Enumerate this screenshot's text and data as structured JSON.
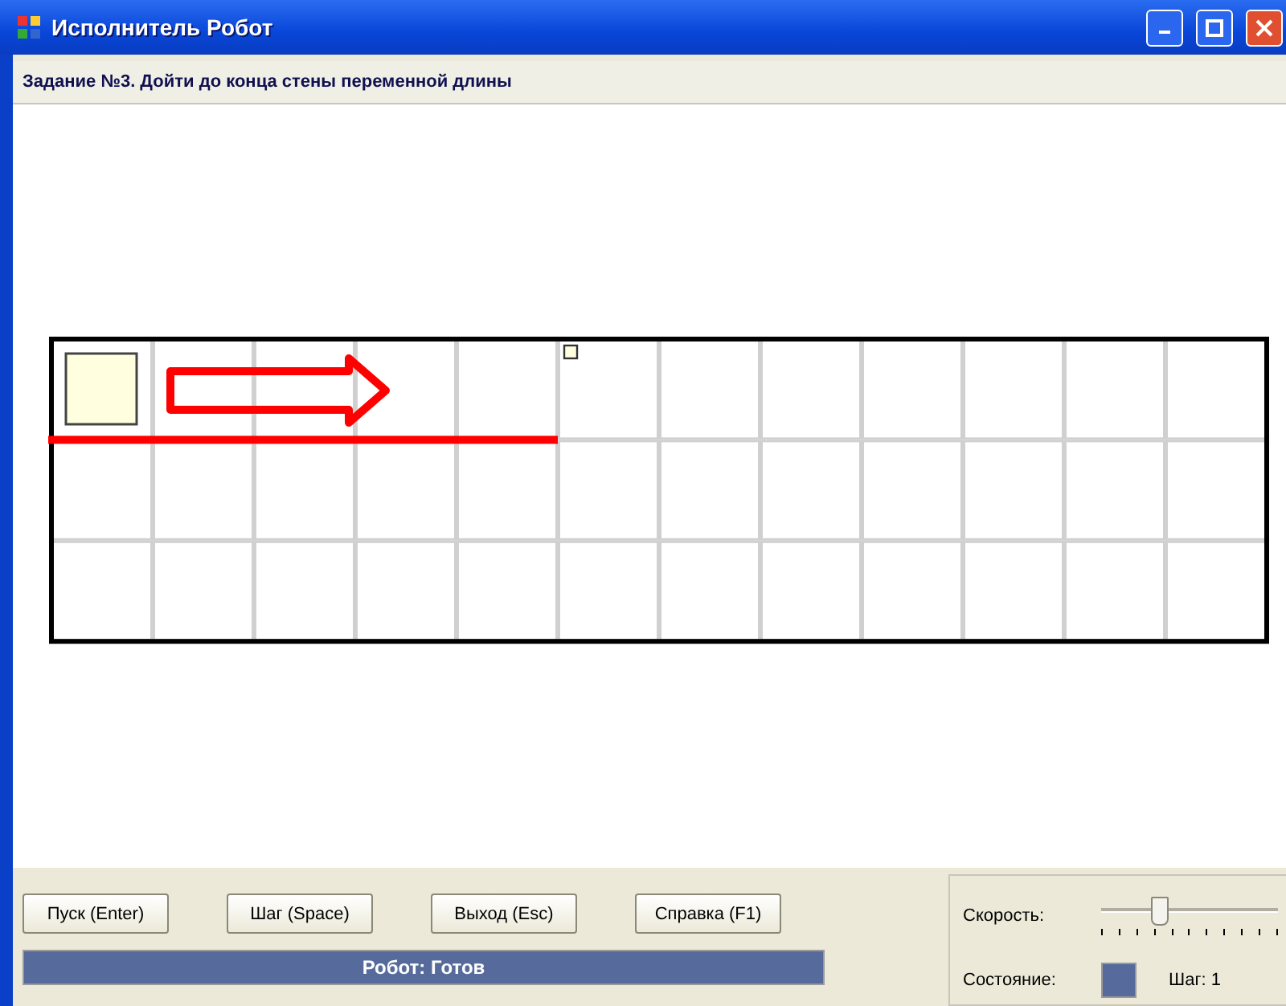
{
  "window": {
    "title": "Исполнитель Робот"
  },
  "task": "Задание №3. Дойти до конца стены переменной длины",
  "board": {
    "rows": [
      {
        "cells": [
          {
            "robot": true,
            "marker": false,
            "wall_below": true
          },
          {
            "robot": false,
            "marker": false,
            "wall_below": true
          },
          {
            "robot": false,
            "marker": false,
            "wall_below": true
          },
          {
            "robot": false,
            "marker": false,
            "wall_below": true
          },
          {
            "robot": false,
            "marker": false,
            "wall_below": true
          },
          {
            "robot": false,
            "marker": true,
            "wall_below": false
          },
          {
            "robot": false,
            "marker": false,
            "wall_below": false
          },
          {
            "robot": false,
            "marker": false,
            "wall_below": false
          },
          {
            "robot": false,
            "marker": false,
            "wall_below": false
          },
          {
            "robot": false,
            "marker": false,
            "wall_below": false
          },
          {
            "robot": false,
            "marker": false,
            "wall_below": false
          },
          {
            "robot": false,
            "marker": false,
            "wall_below": false
          }
        ]
      },
      {
        "cells": [
          {
            "robot": false,
            "marker": false,
            "wall_below": false
          },
          {
            "robot": false,
            "marker": false,
            "wall_below": false
          },
          {
            "robot": false,
            "marker": false,
            "wall_below": false
          },
          {
            "robot": false,
            "marker": false,
            "wall_below": false
          },
          {
            "robot": false,
            "marker": false,
            "wall_below": false
          },
          {
            "robot": false,
            "marker": false,
            "wall_below": false
          },
          {
            "robot": false,
            "marker": false,
            "wall_below": false
          },
          {
            "robot": false,
            "marker": false,
            "wall_below": false
          },
          {
            "robot": false,
            "marker": false,
            "wall_below": false
          },
          {
            "robot": false,
            "marker": false,
            "wall_below": false
          },
          {
            "robot": false,
            "marker": false,
            "wall_below": false
          },
          {
            "robot": false,
            "marker": false,
            "wall_below": false
          }
        ]
      },
      {
        "cells": [
          {
            "robot": false,
            "marker": false,
            "wall_below": false
          },
          {
            "robot": false,
            "marker": false,
            "wall_below": false
          },
          {
            "robot": false,
            "marker": false,
            "wall_below": false
          },
          {
            "robot": false,
            "marker": false,
            "wall_below": false
          },
          {
            "robot": false,
            "marker": false,
            "wall_below": false
          },
          {
            "robot": false,
            "marker": false,
            "wall_below": false
          },
          {
            "robot": false,
            "marker": false,
            "wall_below": false
          },
          {
            "robot": false,
            "marker": false,
            "wall_below": false
          },
          {
            "robot": false,
            "marker": false,
            "wall_below": false
          },
          {
            "robot": false,
            "marker": false,
            "wall_below": false
          },
          {
            "robot": false,
            "marker": false,
            "wall_below": false
          },
          {
            "robot": false,
            "marker": false,
            "wall_below": false
          }
        ]
      }
    ]
  },
  "buttons": [
    "Пуск (Enter)",
    "Шаг (Space)",
    "Выход (Esc)",
    "Справка (F1)"
  ],
  "status": "Робот: Готов",
  "speed": {
    "label": "Скорость:",
    "level": 0.32
  },
  "state": {
    "label": "Состояние:",
    "color": "#566b9c",
    "step": "Шаг: 1"
  }
}
